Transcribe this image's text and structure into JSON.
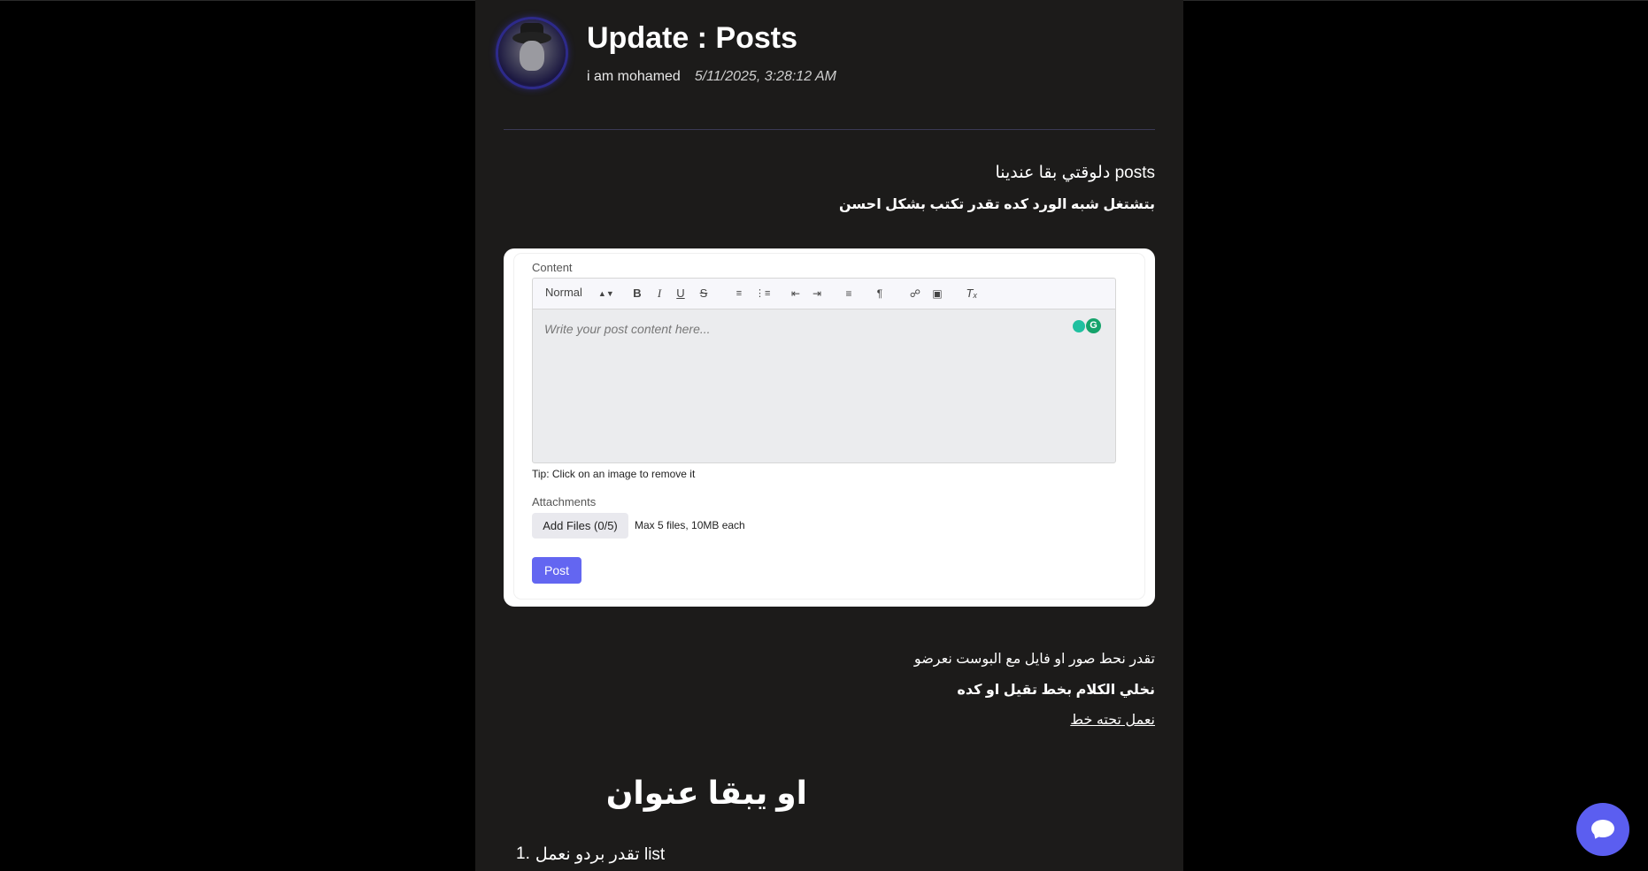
{
  "post": {
    "title": "Update : Posts",
    "author": "i am mohamed",
    "date": "5/11/2025, 3:28:12 AM",
    "body_line1": "posts دلوقتي بقا عندينا",
    "body_line2": "بتشتغل شبه الورد كده تقدر تكتب بشكل احسن",
    "body_line3": "تقدر نحط صور او فايل مع البوست نعرضو",
    "body_line4": "نخلي الكلام بخط تقيل او كده",
    "body_line5": "نعمل تحته خط",
    "heading": "او يبقا عنوان",
    "list": [
      {
        "number": "1.",
        "text": "تقدر بردو نعمل list"
      }
    ]
  },
  "editor": {
    "content_label": "Content",
    "format_select": "Normal",
    "toolbar_icons": [
      "bold-icon",
      "italic-icon",
      "underline-icon",
      "strike-icon",
      "ordered-list-icon",
      "bullet-list-icon",
      "outdent-icon",
      "indent-icon",
      "align-icon",
      "rtl-direction-icon",
      "link-icon",
      "image-icon",
      "clear-format-icon"
    ],
    "placeholder": "Write your post content here...",
    "tip": "Tip: Click on an image to remove it",
    "attachments_label": "Attachments",
    "add_files_label": "Add Files (0/5)",
    "max_note": "Max 5 files, 10MB each",
    "post_label": "Post"
  },
  "colors": {
    "accent": "#6366f1",
    "panel": "#1c1b1a",
    "page": "#000000"
  },
  "chat": {
    "icon": "chat-bubble-icon"
  }
}
